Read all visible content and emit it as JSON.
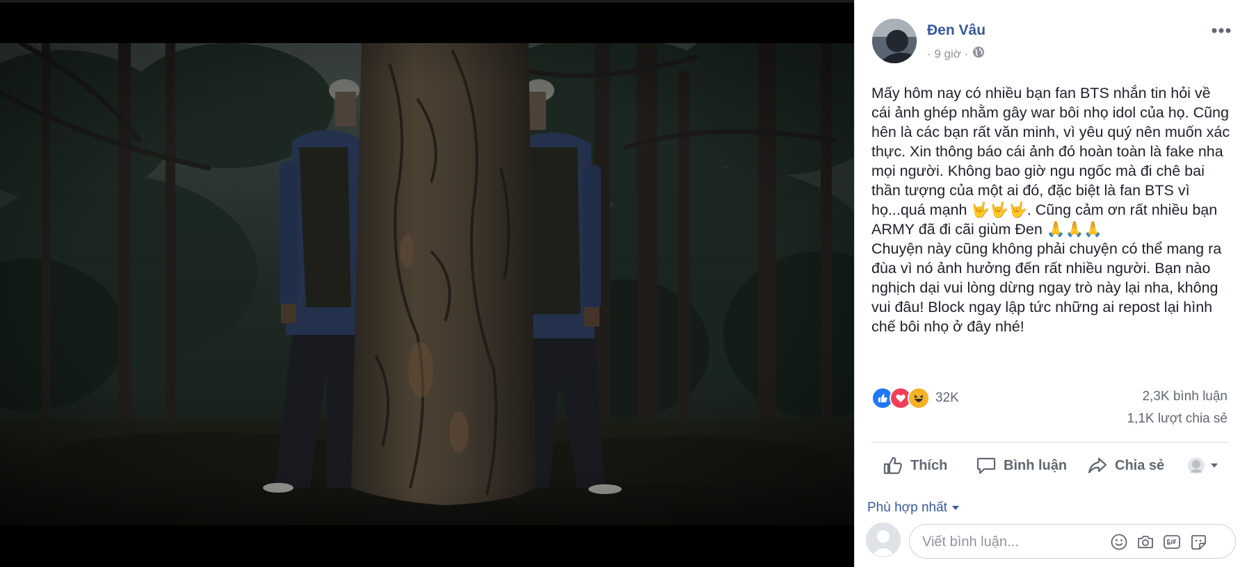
{
  "post": {
    "author": "Đen Vâu",
    "time": "· 9 giờ ·",
    "privacy_icon": "globe-icon",
    "text": "Mấy hôm nay có nhiều bạn fan BTS nhắn tin hỏi về cái ảnh ghép nhằm gây war bôi nhọ idol của họ. Cũng hên là các bạn rất văn minh, vì yêu quý nên muốn xác thực. Xin thông báo cái ảnh đó hoàn toàn là fake nha mọi người. Không bao giờ ngu ngốc mà đi chê bai thần tượng của một ai đó, đặc biệt là fan BTS vì họ...quá mạnh 🤟🤟🤟. Cũng cảm ơn rất nhiều bạn ARMY đã đi cãi giùm Đen 🙏🙏🙏\nChuyện này cũng không phải chuyện có thể mang ra đùa vì nó ảnh hưởng đến rất nhiều người. Bạn nào nghịch dại vui lòng dừng ngay trò này lại nha, không vui đâu! Block ngay lập tức những ai repost lại hình chế bôi nhọ ở đây nhé!"
  },
  "stats": {
    "reaction_icons": [
      "like-icon",
      "love-icon",
      "haha-icon"
    ],
    "reactions": "32K",
    "comments": "2,3K bình luận",
    "shares": "1,1K lượt chia sẻ"
  },
  "actions": {
    "like": "Thích",
    "comment": "Bình luận",
    "share": "Chia sẻ"
  },
  "comments_sort": "Phù hợp nhất",
  "composer": {
    "placeholder": "Viết bình luận...",
    "tools": [
      "emoji-icon",
      "camera-icon",
      "gif-icon",
      "sticker-icon"
    ]
  },
  "colors": {
    "link_blue": "#385898",
    "text": "#1d2129",
    "muted": "#606770",
    "like_blue": "#2078f4",
    "love_red": "#f33e58",
    "haha_yellow": "#f7b125"
  }
}
